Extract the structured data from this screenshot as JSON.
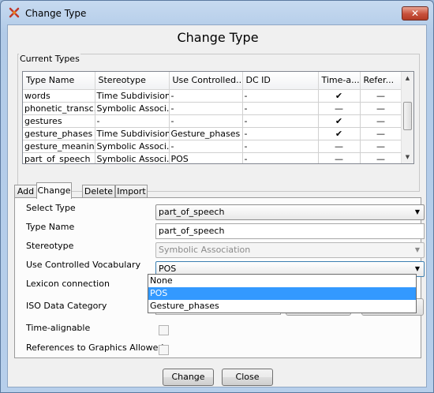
{
  "window": {
    "title": "Change Type"
  },
  "dialog": {
    "heading": "Change Type"
  },
  "current_types": {
    "group_label": "Current Types",
    "columns": [
      "Type Name",
      "Stereotype",
      "Use Controlled...",
      "DC ID",
      "Time-a...",
      "Refer..."
    ],
    "rows": [
      [
        "words",
        "Time Subdivision",
        "-",
        "-",
        "✔",
        "—"
      ],
      [
        "phonetic_transc...",
        "Symbolic Associ...",
        "-",
        "-",
        "—",
        "—"
      ],
      [
        "gestures",
        "-",
        "-",
        "-",
        "✔",
        "—"
      ],
      [
        "gesture_phases",
        "Time Subdivision",
        "Gesture_phases",
        "-",
        "✔",
        "—"
      ],
      [
        "gesture_meaning",
        "Symbolic Associ...",
        "-",
        "-",
        "—",
        "—"
      ],
      [
        "part_of_speech",
        "Symbolic Associ...",
        "POS",
        "-",
        "—",
        "—"
      ]
    ]
  },
  "tabs": [
    "Add",
    "Change",
    "Delete",
    "Import"
  ],
  "form": {
    "select_type_label": "Select Type",
    "select_type_value": "part_of_speech",
    "type_name_label": "Type Name",
    "type_name_value": "part_of_speech",
    "stereotype_label": "Stereotype",
    "stereotype_value": "Symbolic Association",
    "ucv_label": "Use Controlled Vocabulary",
    "ucv_value": "POS",
    "lexicon_label": "Lexicon connection",
    "iso_label": "ISO Data Category",
    "time_alignable_label": "Time-alignable",
    "refs_label": "References to Graphics Allowed"
  },
  "vocab_options": [
    "None",
    "POS",
    "Gesture_phases"
  ],
  "vocab_selected": "POS",
  "buttons": {
    "change": "Change",
    "close": "Close"
  },
  "icons": {
    "app": "elan-app-icon",
    "close": "close-icon",
    "dropdown": "chevron-down-icon"
  }
}
